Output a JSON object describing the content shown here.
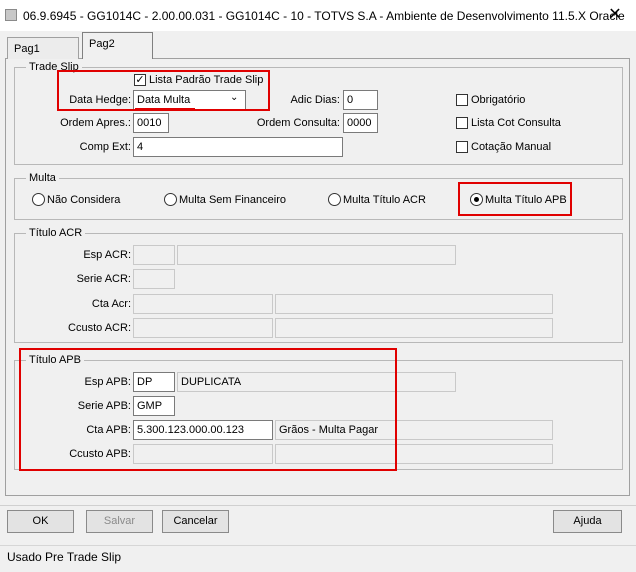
{
  "window": {
    "title": "06.9.6945 - GG1014C - 2.00.00.031 - GG1014C - 10 - TOTVS S.A - Ambiente de Desenvolvimento 11.5.X Oracle",
    "close_glyph": "✕"
  },
  "tabs": [
    {
      "label": "Pag1"
    },
    {
      "label": "Pag2"
    }
  ],
  "trade_slip": {
    "title": "Trade Slip",
    "lista_padrao_label": "Lista Padrão Trade Slip",
    "lista_padrao_checked": true,
    "data_hedge_label": "Data Hedge:",
    "data_hedge_value": "Data Multa",
    "adic_dias_label": "Adic Dias:",
    "adic_dias_value": "0",
    "obrigatorio_label": "Obrigatório",
    "ordem_apres_label": "Ordem Apres.:",
    "ordem_apres_value": "0010",
    "ordem_consulta_label": "Ordem Consulta:",
    "ordem_consulta_value": "0000",
    "lista_cot_label": "Lista Cot Consulta",
    "comp_ext_label": "Comp Ext:",
    "comp_ext_value": "4",
    "cotacao_label": "Cotação Manual"
  },
  "multa": {
    "title": "Multa",
    "options": [
      {
        "label": "Não Considera",
        "selected": false
      },
      {
        "label": "Multa Sem Financeiro",
        "selected": false
      },
      {
        "label": "Multa Título ACR",
        "selected": false
      },
      {
        "label": "Multa Título APB",
        "selected": true
      }
    ]
  },
  "titulo_acr": {
    "title": "Título ACR",
    "esp_label": "Esp ACR:",
    "serie_label": "Serie ACR:",
    "cta_label": "Cta Acr:",
    "ccusto_label": "Ccusto ACR:"
  },
  "titulo_apb": {
    "title": "Título APB",
    "esp_label": "Esp APB:",
    "esp_value": "DP",
    "esp_desc": "DUPLICATA",
    "serie_label": "Serie APB:",
    "serie_value": "GMP",
    "cta_label": "Cta APB:",
    "cta_value": "5.300.123.000.00.123",
    "cta_desc": "Grãos - Multa Pagar",
    "ccusto_label": "Ccusto APB:"
  },
  "buttons": {
    "ok": "OK",
    "salvar": "Salvar",
    "cancelar": "Cancelar",
    "ajuda": "Ajuda"
  },
  "status": "Usado Pre Trade Slip",
  "colors": {
    "highlight": "#e00000",
    "underline": "#e00000"
  }
}
